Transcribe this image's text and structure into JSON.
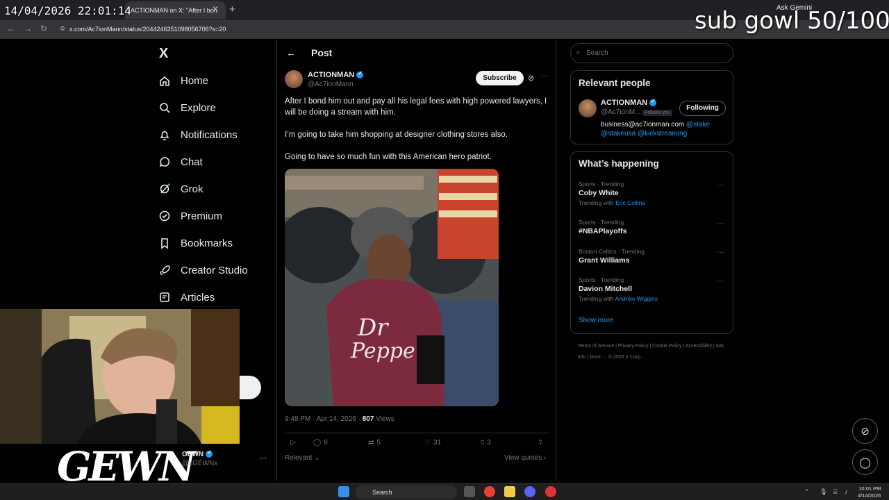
{
  "overlay": {
    "timestamp": "14/04/2026 22:01:14",
    "sub_goal": "sub gowl 50/100",
    "streamer_logo": "GEWN"
  },
  "browser": {
    "tab_title": "ACTIONMAN on X: \"After I bon",
    "ask_gemini": "Ask Gemini",
    "url": "x.com/Ac7ionMann/status/2044246351098056706?s=20"
  },
  "nav": {
    "logo": "X",
    "items": [
      {
        "label": "Home",
        "icon": "home-icon"
      },
      {
        "label": "Explore",
        "icon": "search-icon"
      },
      {
        "label": "Notifications",
        "icon": "bell-icon"
      },
      {
        "label": "Chat",
        "icon": "chat-icon"
      },
      {
        "label": "Grok",
        "icon": "grok-icon"
      },
      {
        "label": "Premium",
        "icon": "premium-icon"
      },
      {
        "label": "Bookmarks",
        "icon": "bookmark-icon"
      },
      {
        "label": "Creator Studio",
        "icon": "rocket-icon"
      },
      {
        "label": "Articles",
        "icon": "article-icon"
      }
    ],
    "profile": {
      "name": "GEWN",
      "handle": "@xGEWNx"
    }
  },
  "post": {
    "header": "Post",
    "author_name": "ACTIONMAN",
    "author_handle": "@Ac7ionMann",
    "subscribe_label": "Subscribe",
    "paragraphs": [
      "After I bond him out and pay all his legal fees with high powered lawyers, I will be doing a stream with him.",
      "I’m going to take him shopping at designer clothing stores also.",
      "Going to have so much fun with this American hero patriot."
    ],
    "timestamp": "9:48 PM · Apr 14, 2026 · ",
    "views_count": "807",
    "views_label": " Views",
    "replies": "8",
    "reposts": "5",
    "likes": "31",
    "bookmarks": "3",
    "relevant_label": "Relevant",
    "view_quotes_label": "View quotes"
  },
  "sidebar": {
    "search_placeholder": "Search",
    "relevant_people": {
      "title": "Relevant people",
      "name": "ACTIONMAN",
      "handle": "@Ac7ionM...",
      "follows_you": "Follows you",
      "following_label": "Following",
      "bio_email": "business@ac7ionman.com ",
      "bio_link1": "@stake",
      "bio_link2": "@stakeusa @kickstreaming"
    },
    "happening": {
      "title": "What’s happening",
      "trends": [
        {
          "category": "Sports · Trending",
          "name": "Coby White",
          "with_prefix": "Trending with ",
          "with": "Eric Collins"
        },
        {
          "category": "Sports · Trending",
          "name": "#NBAPlayoffs",
          "with_prefix": "",
          "with": ""
        },
        {
          "category": "Boston Celtics · Trending",
          "name": "Grant Williams",
          "with_prefix": "",
          "with": ""
        },
        {
          "category": "Sports · Trending",
          "name": "Davion Mitchell",
          "with_prefix": "Trending with ",
          "with": "Andrew Wiggins"
        }
      ],
      "show_more": "Show more"
    },
    "footer": "Terms of Service  |  Privacy Policy  |  Cookie Policy  |  Accessibility  |  Ads info  |  More ···  © 2026 X Corp."
  },
  "taskbar": {
    "search": "Search",
    "time": "10:01 PM",
    "date": "4/14/2026"
  }
}
